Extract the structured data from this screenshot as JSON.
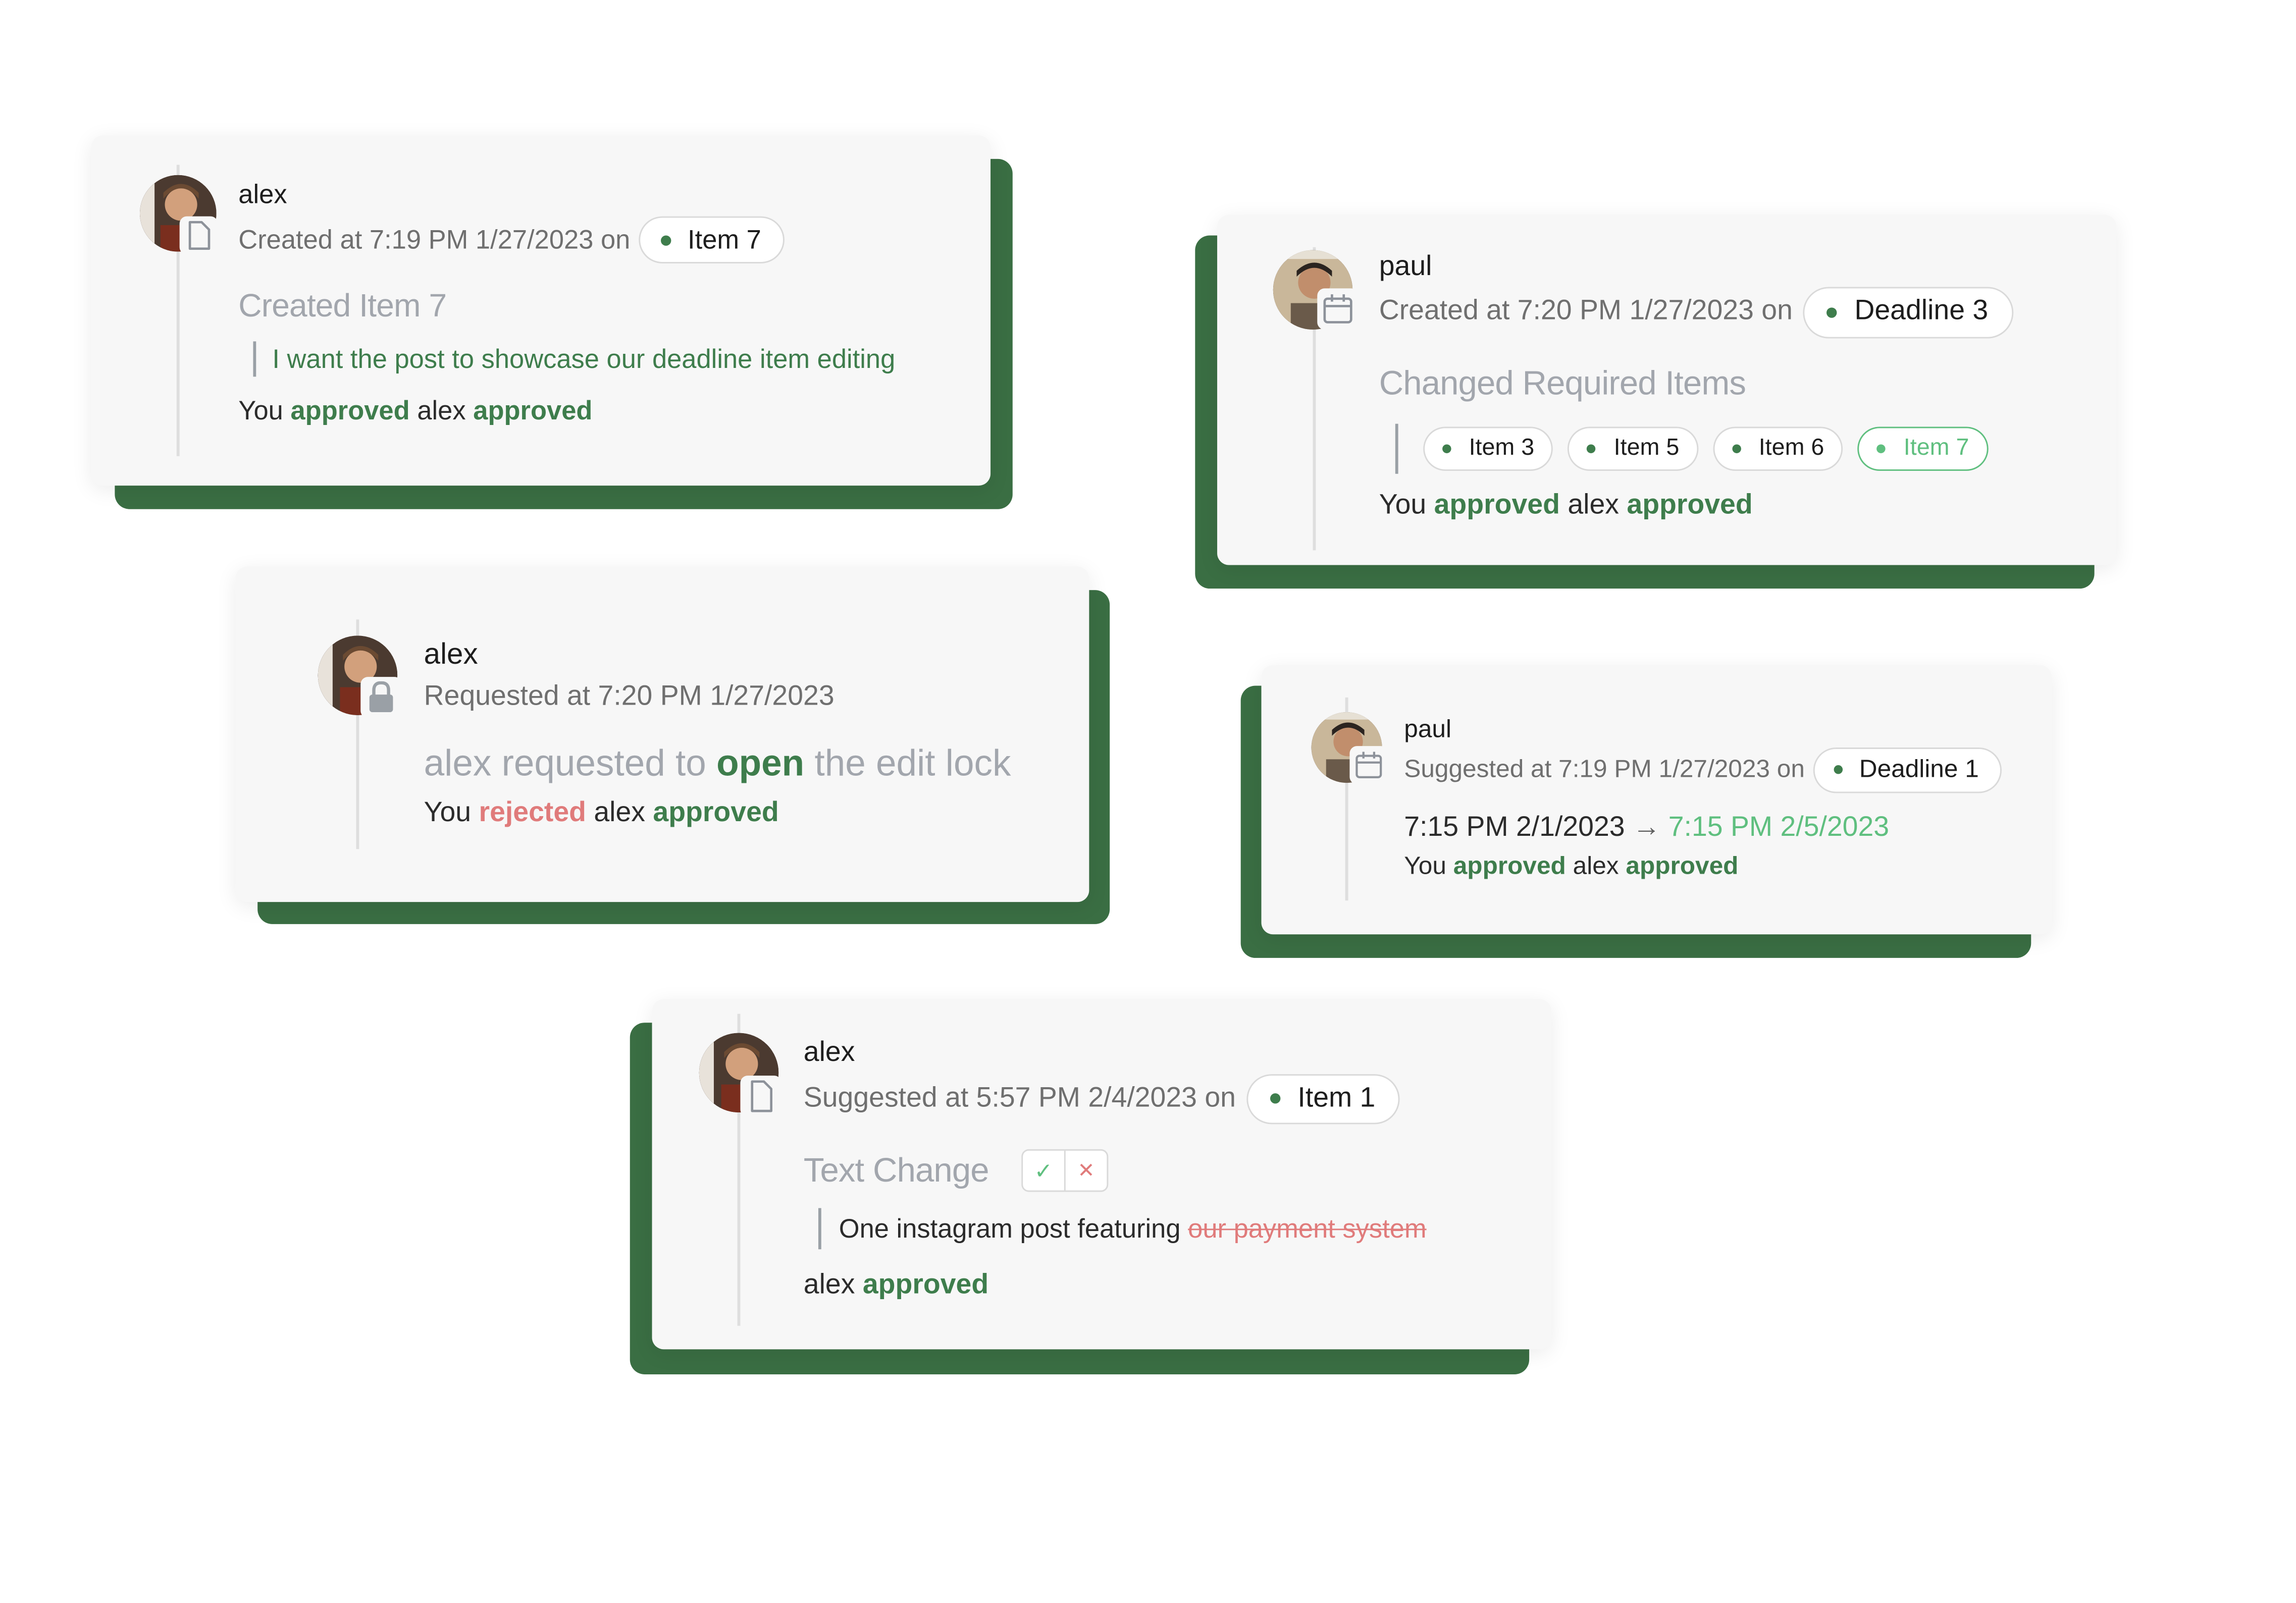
{
  "colors": {
    "accent_green": "#3e7d4c",
    "light_green": "#5fbf7f",
    "reject_red": "#e07b7b",
    "card_bg": "#f7f7f7",
    "shadow_green": "#3a6e43",
    "muted_gray": "#a2a6ad"
  },
  "cards": [
    {
      "user": "alex",
      "icon": "document-icon",
      "meta": "Created at 7:19 PM 1/27/2023 on",
      "chip": "Item 7",
      "title": "Created Item 7",
      "quote": "I want the post to showcase our deadline item editing",
      "status": {
        "you": "You",
        "you_action": "approved",
        "other": "alex",
        "other_action": "approved"
      }
    },
    {
      "user": "paul",
      "icon": "calendar-icon",
      "meta": "Created at 7:20 PM 1/27/2023 on",
      "chip": "Deadline 3",
      "title": "Changed Required Items",
      "items": [
        "Item 3",
        "Item 5",
        "Item 6",
        "Item 7"
      ],
      "status": {
        "you": "You",
        "you_action": "approved",
        "other": "alex",
        "other_action": "approved"
      }
    },
    {
      "user": "alex",
      "icon": "lock-icon",
      "meta": "Requested at 7:20 PM 1/27/2023",
      "title_before": "alex requested to",
      "title_highlight": "open",
      "title_after": "the edit lock",
      "status": {
        "you": "You",
        "you_action": "rejected",
        "other": "alex",
        "other_action": "approved"
      }
    },
    {
      "user": "paul",
      "icon": "calendar-icon",
      "meta": "Suggested at 7:19 PM 1/27/2023 on",
      "chip": "Deadline 1",
      "date_old": "7:15 PM 2/1/2023",
      "arrow": "→",
      "date_new": "7:15 PM 2/5/2023",
      "status": {
        "you": "You",
        "you_action": "approved",
        "other": "alex",
        "other_action": "approved"
      }
    },
    {
      "user": "alex",
      "icon": "document-icon",
      "meta": "Suggested at 5:57 PM 2/4/2023 on",
      "chip": "Item 1",
      "title": "Text Change",
      "accept_glyph": "✓",
      "reject_glyph": "✕",
      "quote_text": "One instagram post featuring",
      "quote_struck": "our payment system",
      "status": {
        "other": "alex",
        "other_action": "approved"
      }
    }
  ]
}
